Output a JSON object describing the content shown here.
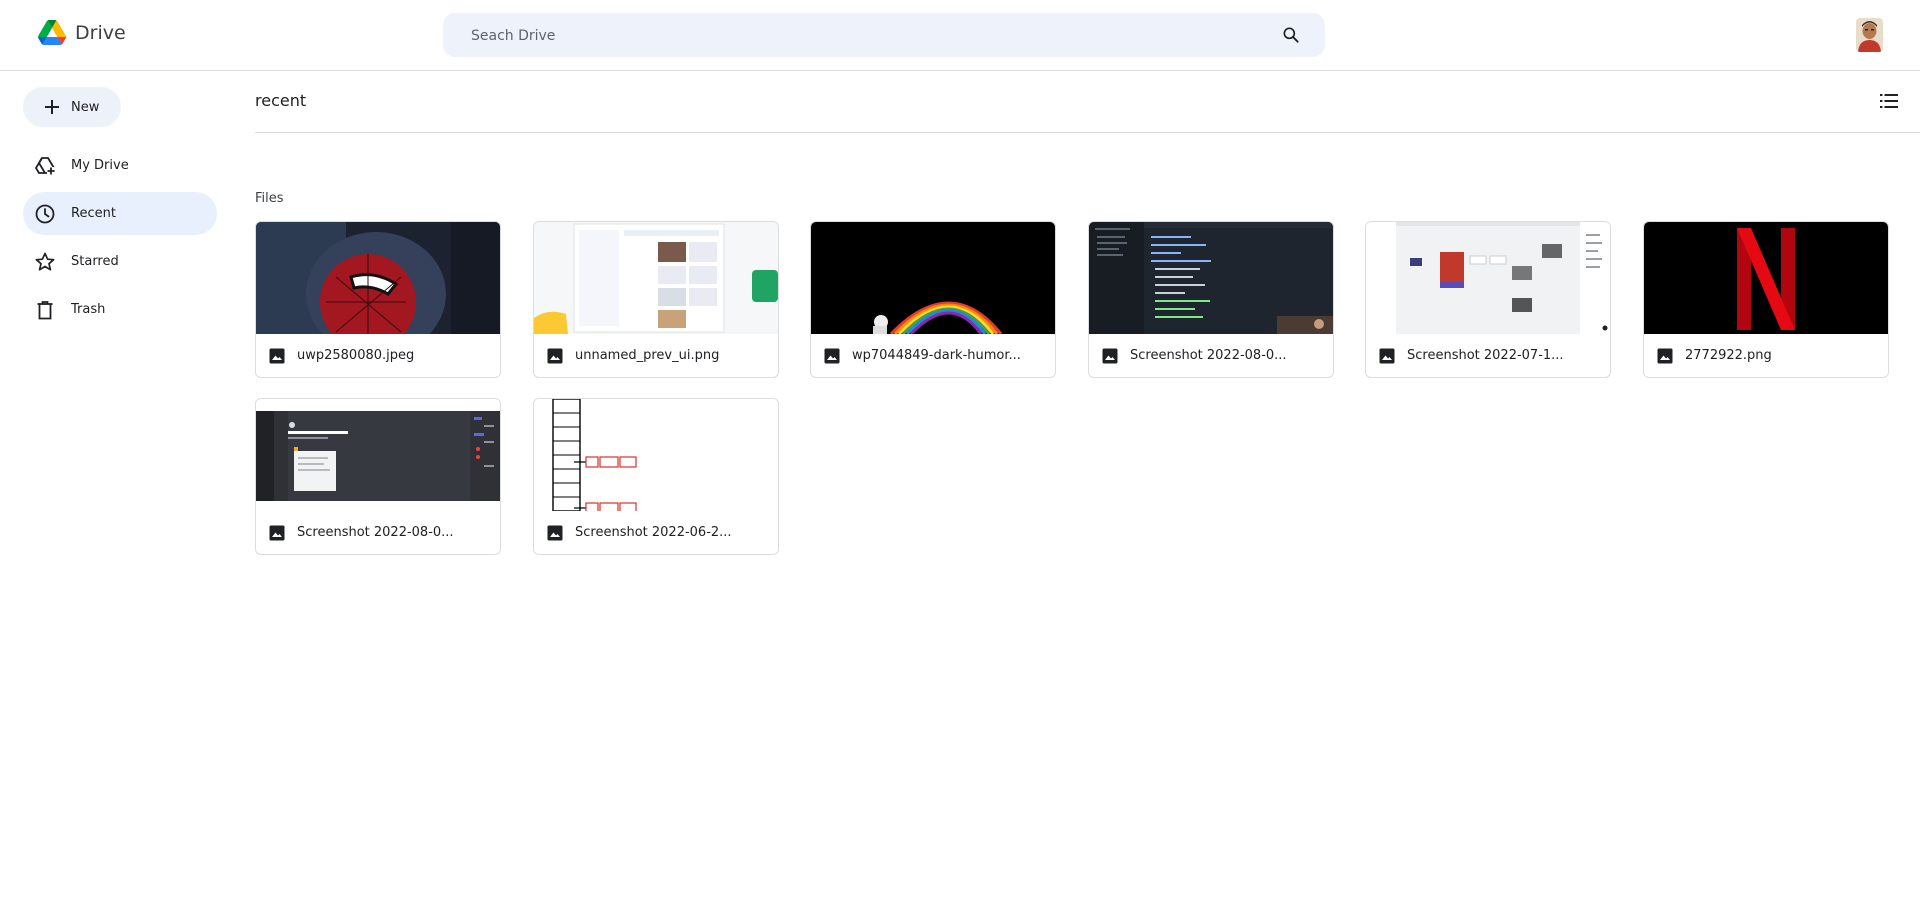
{
  "app": {
    "name": "Drive"
  },
  "search": {
    "placeholder": "Seach Drive"
  },
  "sidebar": {
    "new_label": "New",
    "items": [
      {
        "label": "My Drive",
        "icon": "drive-icon",
        "active": false
      },
      {
        "label": "Recent",
        "icon": "clock-icon",
        "active": true
      },
      {
        "label": "Starred",
        "icon": "star-icon",
        "active": false
      },
      {
        "label": "Trash",
        "icon": "trash-icon",
        "active": false
      }
    ]
  },
  "main": {
    "title": "recent",
    "section_label": "Files",
    "files": [
      {
        "name": "uwp2580080.jpeg",
        "type": "image-icon"
      },
      {
        "name": "unnamed_prev_ui.png",
        "type": "image-icon"
      },
      {
        "name": "wp7044849-dark-humor...",
        "type": "image-icon"
      },
      {
        "name": "Screenshot 2022-08-0...",
        "type": "image-icon"
      },
      {
        "name": "Screenshot 2022-07-1...",
        "type": "image-icon"
      },
      {
        "name": "2772922.png",
        "type": "image-icon"
      },
      {
        "name": "Screenshot 2022-08-0...",
        "type": "image-icon"
      },
      {
        "name": "Screenshot 2022-06-2...",
        "type": "image-icon"
      }
    ]
  },
  "colors": {
    "accent_active": "#e8f0fe",
    "new_button_bg": "#edf2fa",
    "search_bg": "#eef3fb",
    "border": "#dadce0"
  }
}
